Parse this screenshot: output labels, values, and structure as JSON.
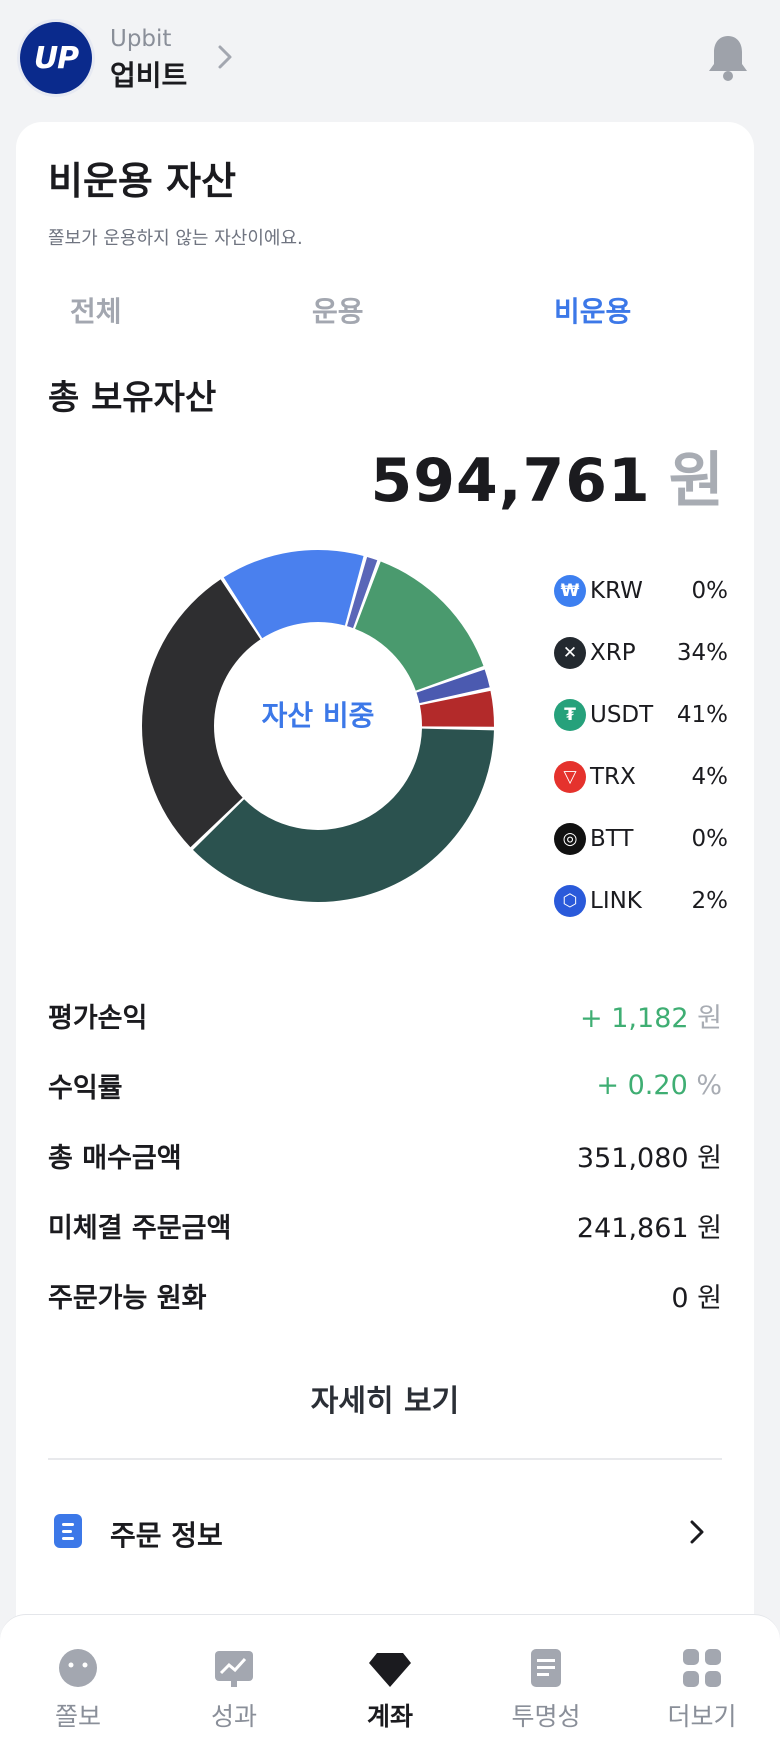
{
  "header": {
    "logo_text": "UP",
    "brand_en": "Upbit",
    "brand_ko": "업비트"
  },
  "card": {
    "title": "비운용 자산",
    "subtitle": "쫄보가 운용하지 않는 자산이에요.",
    "tabs": [
      {
        "label": "전체",
        "active": false
      },
      {
        "label": "운용",
        "active": false
      },
      {
        "label": "비운용",
        "active": true
      }
    ],
    "section_title": "총 보유자산",
    "total_value": "594,761",
    "total_unit": "원",
    "donut_label": "자산 비중"
  },
  "chart_data": {
    "type": "pie",
    "slices": [
      {
        "color": "#4a80ee",
        "value": 13.5
      },
      {
        "color": "#5a66b8",
        "value": 1.3
      },
      {
        "color": "#4a9a6e",
        "value": 14.0
      },
      {
        "color": "#4b5ab0",
        "value": 2.0
      },
      {
        "color": "#b32a2a",
        "value": 3.6
      },
      {
        "color": "#2b524f",
        "value": 37.5
      },
      {
        "color": "#2e2e30",
        "value": 28.1
      }
    ]
  },
  "legend": [
    {
      "name": "KRW",
      "pct": "0%",
      "icon": "krw-icon",
      "color": "#3d7ff0",
      "glyph": "₩"
    },
    {
      "name": "XRP",
      "pct": "34%",
      "icon": "xrp-icon",
      "color": "#23292f",
      "glyph": "✕"
    },
    {
      "name": "USDT",
      "pct": "41%",
      "icon": "usdt-icon",
      "color": "#26a17b",
      "glyph": "₮"
    },
    {
      "name": "TRX",
      "pct": "4%",
      "icon": "trx-icon",
      "color": "#e5322d",
      "glyph": "▽"
    },
    {
      "name": "BTT",
      "pct": "0%",
      "icon": "btt-icon",
      "color": "#111111",
      "glyph": "◎"
    },
    {
      "name": "LINK",
      "pct": "2%",
      "icon": "link-icon",
      "color": "#2a5ada",
      "glyph": "⬡"
    }
  ],
  "stats": [
    {
      "label": "평가손익",
      "value": "+ 1,182",
      "unit": "원",
      "green": true
    },
    {
      "label": "수익률",
      "value": "+ 0.20",
      "unit": "%",
      "green": true
    },
    {
      "label": "총 매수금액",
      "value": "351,080",
      "unit": "원",
      "green": false
    },
    {
      "label": "미체결 주문금액",
      "value": "241,861",
      "unit": "원",
      "green": false
    },
    {
      "label": "주문가능 원화",
      "value": "0",
      "unit": "원",
      "green": false
    }
  ],
  "detail_button": "자세히 보기",
  "order_info_label": "주문 정보",
  "nav": [
    {
      "label": "쫄보",
      "icon": "face-icon",
      "active": false
    },
    {
      "label": "성과",
      "icon": "chart-board-icon",
      "active": false
    },
    {
      "label": "계좌",
      "icon": "diamond-icon",
      "active": true
    },
    {
      "label": "투명성",
      "icon": "document-icon",
      "active": false
    },
    {
      "label": "더보기",
      "icon": "grid-icon",
      "active": false
    }
  ]
}
